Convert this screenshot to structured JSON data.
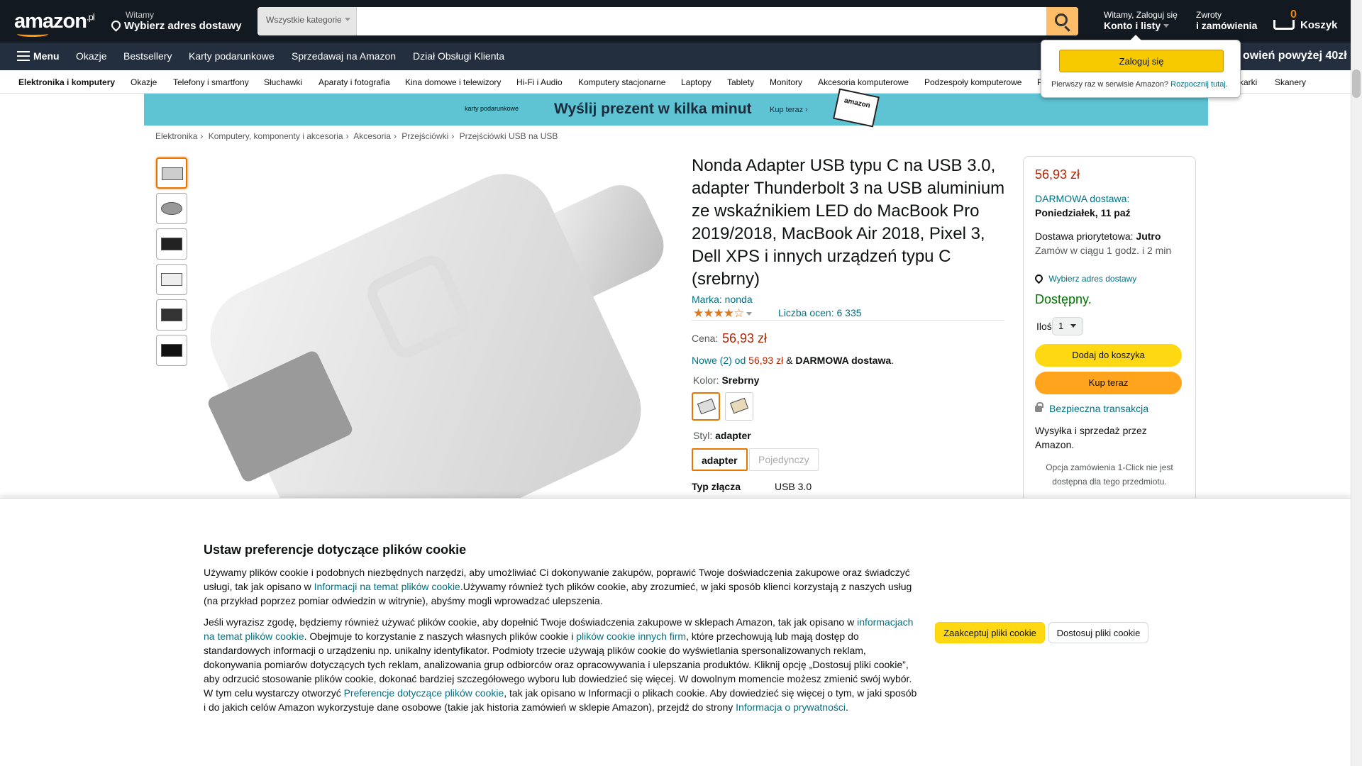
{
  "header": {
    "logo": "amazon",
    "logo_tld": ".pl",
    "deliver_line1": "Witamy",
    "deliver_line2": "Wybierz adres dostawy",
    "search_category": "Wszystkie kategorie",
    "search_placeholder": "",
    "account_line1": "Witamy, Zaloguj się",
    "account_line2": "Konto i listy",
    "returns_line1": "Zwroty",
    "returns_line2": "i zamówienia",
    "cart_count": "0",
    "cart_label": "Koszyk"
  },
  "nav": {
    "menu": "Menu",
    "items": [
      "Okazje",
      "Bestsellery",
      "Karty podarunkowe",
      "Sprzedawaj na Amazon",
      "Dział Obsługi Klienta"
    ],
    "promo": "owień powyżej 40zł"
  },
  "subnav": [
    "Elektronika i komputery",
    "Okazje",
    "Telefony i smartfony",
    "Słuchawki",
    "Aparaty i fotografia",
    "Kina domowe i telewizory",
    "Hi-Fi i Audio",
    "Komputery stacjonarne",
    "Laptopy",
    "Tablety",
    "Monitory",
    "Akcesoria komputerowe",
    "Podzespoły komputerowe",
    "P",
    "karki",
    "Skanery"
  ],
  "banner": {
    "small": "karty podarunkowe",
    "big": "Wyślij prezent w kilka minut",
    "cta": "Kup teraz ›",
    "gift": "amazon"
  },
  "breadcrumb": [
    "Elektronika",
    "Komputery, komponenty i akcesoria",
    "Akcesoria",
    "Przejściówki",
    "Przejściówki USB na USB"
  ],
  "product": {
    "title": "Nonda Adapter USB typu C na USB 3.0, adapter Thunderbolt 3 na USB aluminium ze wskaźnikiem LED do MacBook Pro 2019/2018, MacBook Air 2018, Pixel 3, Dell XPS i innych urządzeń typu C (srebrny)",
    "brand": "Marka: nonda",
    "stars": "★★★★☆",
    "rating_count": "Liczba ocen: 6 335",
    "price_label": "Cena:",
    "price": "56,93 zł",
    "offers_link": "Nowe (2) od",
    "offers_price": "56,93 zł",
    "offers_amp": "&",
    "offers_free": "DARMOWA dostawa",
    "offers_dot": ".",
    "color_label": "Kolor:",
    "color_value": "Srebrny",
    "style_label": "Styl:",
    "style_value": "adapter",
    "style_options": [
      "adapter",
      "Pojedynczy"
    ],
    "spec_label": "Typ złącza",
    "spec_value": "USB 3.0"
  },
  "buybox": {
    "price": "56,93 zł",
    "free_delivery": "DARMOWA dostawa:",
    "delivery_date": "Poniedziałek, 11 paź",
    "priority_label": "Dostawa priorytetowa:",
    "priority_value": "Jutro",
    "order_within": "Zamów w ciągu 1 godz. i 2 min",
    "address": "Wybierz adres dostawy",
    "availability": "Dostępny.",
    "qty_label": "Ilość:",
    "qty_value": "1",
    "add_to_cart": "Dodaj do koszyka",
    "buy_now": "Kup teraz",
    "secure": "Bezpieczna transakcja",
    "sold_by": "Wysyłka i sprzedaż przez Amazon.",
    "one_click": "Opcja zamówienia 1-Click nie jest dostępna dla tego przedmiotu."
  },
  "signin_popup": {
    "button": "Zaloguj się",
    "new_customer": "Pierwszy raz w serwisie Amazon?",
    "start_link": "Rozpocznij tutaj."
  },
  "cookie": {
    "title": "Ustaw preferencje dotyczące plików cookie",
    "p1_a": "Używamy plików cookie i podobnych niezbędnych narzędzi, aby umożliwiać Ci dokonywanie zakupów, poprawić Twoje doświadczenia zakupowe oraz świadczyć usługi, tak jak opisano w ",
    "p1_link": "Informacji na temat plików cookie",
    "p1_b": ".Używamy również tych plików cookie, aby zrozumieć, w jaki sposób klienci korzystają z naszych usług (na przykład poprzez pomiar odwiedzin w witrynie), abyśmy mogli wprowadzać ulepszenia.",
    "p2_a": "Jeśli wyrazisz zgodę, będziemy również używać plików cookie, aby dopełnić Twoje doświadczenia zakupowe w sklepach Amazon, tak jak opisano w ",
    "p2_link1": "informacjach na temat plików cookie",
    "p2_b": ". Obejmuje to korzystanie z naszych własnych plików cookie i ",
    "p2_link2": "plików cookie innych firm",
    "p2_c": ", które przechowują lub mają dostęp do standardowych informacji o urządzeniu np. unikalny identyfikator. Podmioty trzecie używają plików cookie do wyświetlania spersonalizowanych reklam, dokonywania pomiarów dotyczących tych reklam, analizowania grup odbiorców oraz opracowywania i ulepszania produktów. Kliknij opcję „Dostosuj pliki cookie”, aby odrzucić stosowanie plików cookie, dokonać bardziej szczegółowego wyboru lub dowiedzieć się więcej. W dowolnym momencie możesz zmienić swój wybór. W tym celu wystarczy otworzyć ",
    "p2_link3": "Preferencje dotyczące plików cookie",
    "p2_d": ", tak jak opisano w Informacji o plikach cookie. Aby dowiedzieć się więcej o tym, w jaki sposób i do jakich celów Amazon wykorzystuje dane osobowe (takie jak historia zamówień w sklepie Amazon), przejdź do strony ",
    "p2_link4": "Informacja o prywatności",
    "p2_e": ".",
    "accept": "Zaakceptuj pliki cookie",
    "customize": "Dostosuj pliki cookie"
  }
}
